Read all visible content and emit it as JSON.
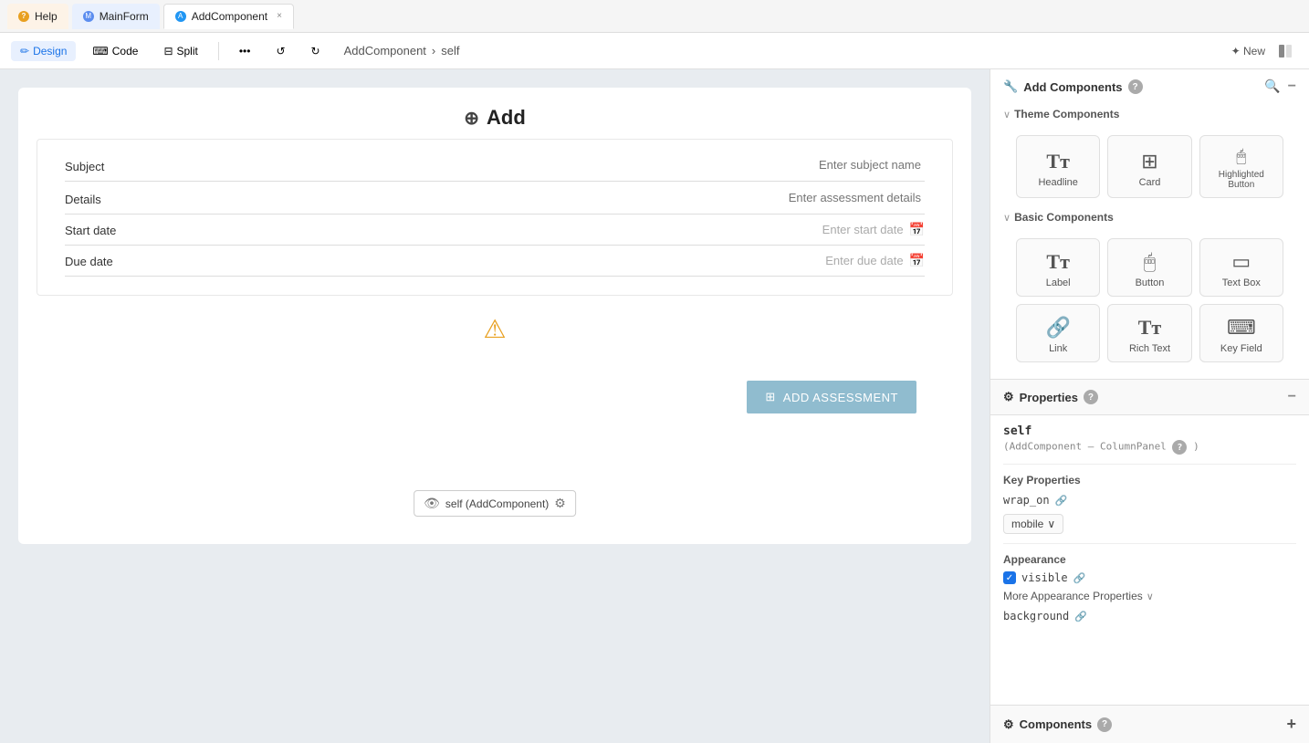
{
  "tabBar": {
    "tabs": [
      {
        "id": "help",
        "label": "Help",
        "icon": "❓",
        "type": "help"
      },
      {
        "id": "mainform",
        "label": "MainForm",
        "icon": "📋",
        "type": "main"
      },
      {
        "id": "addcomponent",
        "label": "AddComponent",
        "icon": "🔵",
        "type": "add",
        "closable": true
      }
    ]
  },
  "toolbar": {
    "design_label": "Design",
    "code_label": "Code",
    "split_label": "Split",
    "breadcrumb_part1": "AddComponent",
    "breadcrumb_sep": "›",
    "breadcrumb_part2": "self",
    "new_label": "✦ New"
  },
  "canvas": {
    "title_icon": "⊕",
    "title": "Add",
    "form_fields": [
      {
        "label": "Subject",
        "placeholder": "Enter subject name",
        "type": "text"
      },
      {
        "label": "Details",
        "placeholder": "Enter assessment details",
        "type": "text"
      },
      {
        "label": "Start date",
        "placeholder": "Enter start date",
        "type": "date"
      },
      {
        "label": "Due date",
        "placeholder": "Enter due date",
        "type": "date"
      }
    ],
    "add_button_label": "ADD ASSESSMENT",
    "self_badge_label": "self (AddComponent)"
  },
  "addComponents": {
    "title": "Add Components",
    "theme_section": "Theme Components",
    "basic_section": "Basic Components",
    "theme_items": [
      {
        "id": "headline",
        "label": "Headline",
        "icon": "Tт"
      },
      {
        "id": "card",
        "label": "Card",
        "icon": "⊞"
      },
      {
        "id": "highlighted-button",
        "label": "Highlighted Button",
        "icon": "🖱"
      }
    ],
    "basic_items": [
      {
        "id": "label",
        "label": "Label",
        "icon": "Tт"
      },
      {
        "id": "button",
        "label": "Button",
        "icon": "🖱"
      },
      {
        "id": "text-box",
        "label": "Text Box",
        "icon": "▭"
      },
      {
        "id": "link",
        "label": "Link",
        "icon": "🔗"
      },
      {
        "id": "rich-text",
        "label": "Rich Text",
        "icon": "Tт"
      },
      {
        "id": "key-field",
        "label": "Key Field",
        "icon": "⌨"
      }
    ]
  },
  "properties": {
    "title": "Properties",
    "component_name": "self",
    "component_type": "(AddComponent – ColumnPanel",
    "question_mark": "?",
    "close_paren": ")",
    "key_properties_label": "Key Properties",
    "wrap_on_key": "wrap_on",
    "wrap_on_value": "mobile",
    "appearance_label": "Appearance",
    "visible_key": "visible",
    "more_appearance_label": "More Appearance Properties",
    "background_key": "background"
  },
  "componentsFooter": {
    "title": "Components"
  }
}
